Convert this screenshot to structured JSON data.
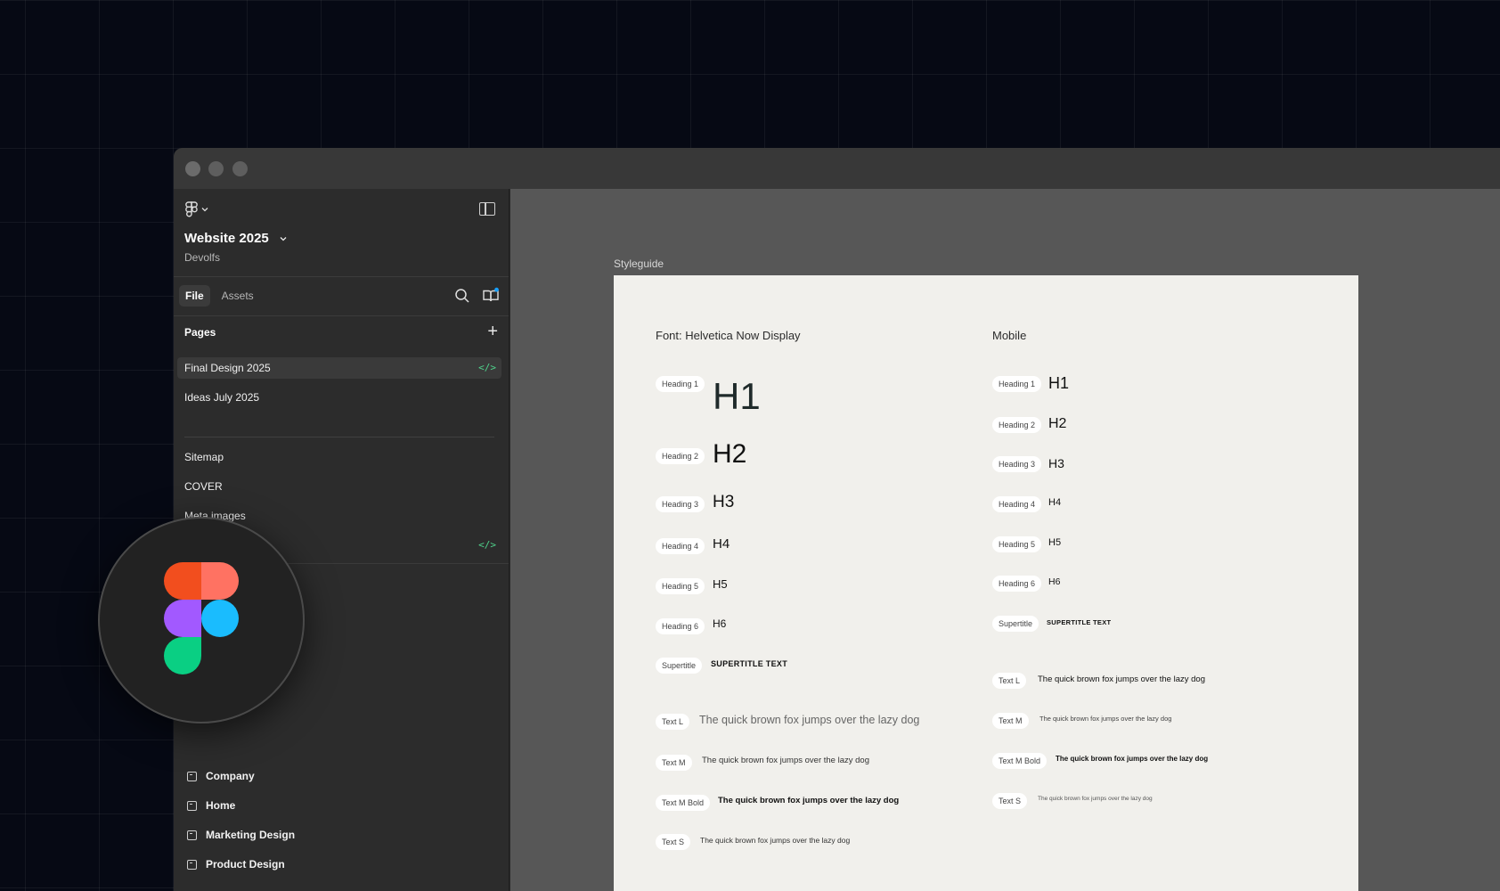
{
  "sidebar": {
    "project_title": "Website 2025",
    "team": "Devolfs",
    "tabs": [
      {
        "label": "File",
        "active": true
      },
      {
        "label": "Assets",
        "active": false
      }
    ],
    "pages_heading": "Pages",
    "pages": [
      {
        "label": "Final Design 2025",
        "selected": true
      },
      {
        "label": "Ideas July 2025",
        "selected": false
      }
    ],
    "extra_pages": [
      {
        "label": "Sitemap"
      },
      {
        "label": "COVER"
      },
      {
        "label": "Meta images"
      }
    ],
    "frames": [
      {
        "label": "Company"
      },
      {
        "label": "Home"
      },
      {
        "label": "Marketing Design"
      },
      {
        "label": "Product Design"
      }
    ]
  },
  "canvas": {
    "frame_label": "Styleguide",
    "desktop": {
      "title": "Font: Helvetica Now Display",
      "rows": [
        {
          "tag": "Heading 1",
          "sample": "H1"
        },
        {
          "tag": "Heading 2",
          "sample": "H2"
        },
        {
          "tag": "Heading 3",
          "sample": "H3"
        },
        {
          "tag": "Heading 4",
          "sample": "H4"
        },
        {
          "tag": "Heading 5",
          "sample": "H5"
        },
        {
          "tag": "Heading 6",
          "sample": "H6"
        },
        {
          "tag": "Supertitle",
          "sample": "SUPERTITLE TEXT"
        },
        {
          "tag": "Text L",
          "sample": "The quick brown fox jumps over the lazy dog"
        },
        {
          "tag": "Text M",
          "sample": "The quick brown fox jumps over the lazy dog"
        },
        {
          "tag": "Text M Bold",
          "sample": "The quick brown fox jumps over the lazy dog"
        },
        {
          "tag": "Text S",
          "sample": "The quick brown fox jumps over the lazy dog"
        }
      ]
    },
    "mobile": {
      "title": "Mobile",
      "rows": [
        {
          "tag": "Heading 1",
          "sample": "H1"
        },
        {
          "tag": "Heading 2",
          "sample": "H2"
        },
        {
          "tag": "Heading 3",
          "sample": "H3"
        },
        {
          "tag": "Heading 4",
          "sample": "H4"
        },
        {
          "tag": "Heading 5",
          "sample": "H5"
        },
        {
          "tag": "Heading 6",
          "sample": "H6"
        },
        {
          "tag": "Supertitle",
          "sample": "SUPERTITLE TEXT"
        },
        {
          "tag": "Text L",
          "sample": "The quick brown fox jumps over the lazy dog"
        },
        {
          "tag": "Text M",
          "sample": "The quick brown fox jumps over the lazy dog"
        },
        {
          "tag": "Text M Bold",
          "sample": "The quick brown fox jumps over the lazy dog"
        },
        {
          "tag": "Text S",
          "sample": "The quick brown fox jumps over the lazy dog"
        }
      ]
    }
  },
  "colors": {
    "code_accent": "#4fd28b",
    "figma_red": "#f24e1e",
    "figma_coral": "#ff7262",
    "figma_purple": "#a259ff",
    "figma_blue": "#1abcfe",
    "figma_green": "#0acf83"
  }
}
